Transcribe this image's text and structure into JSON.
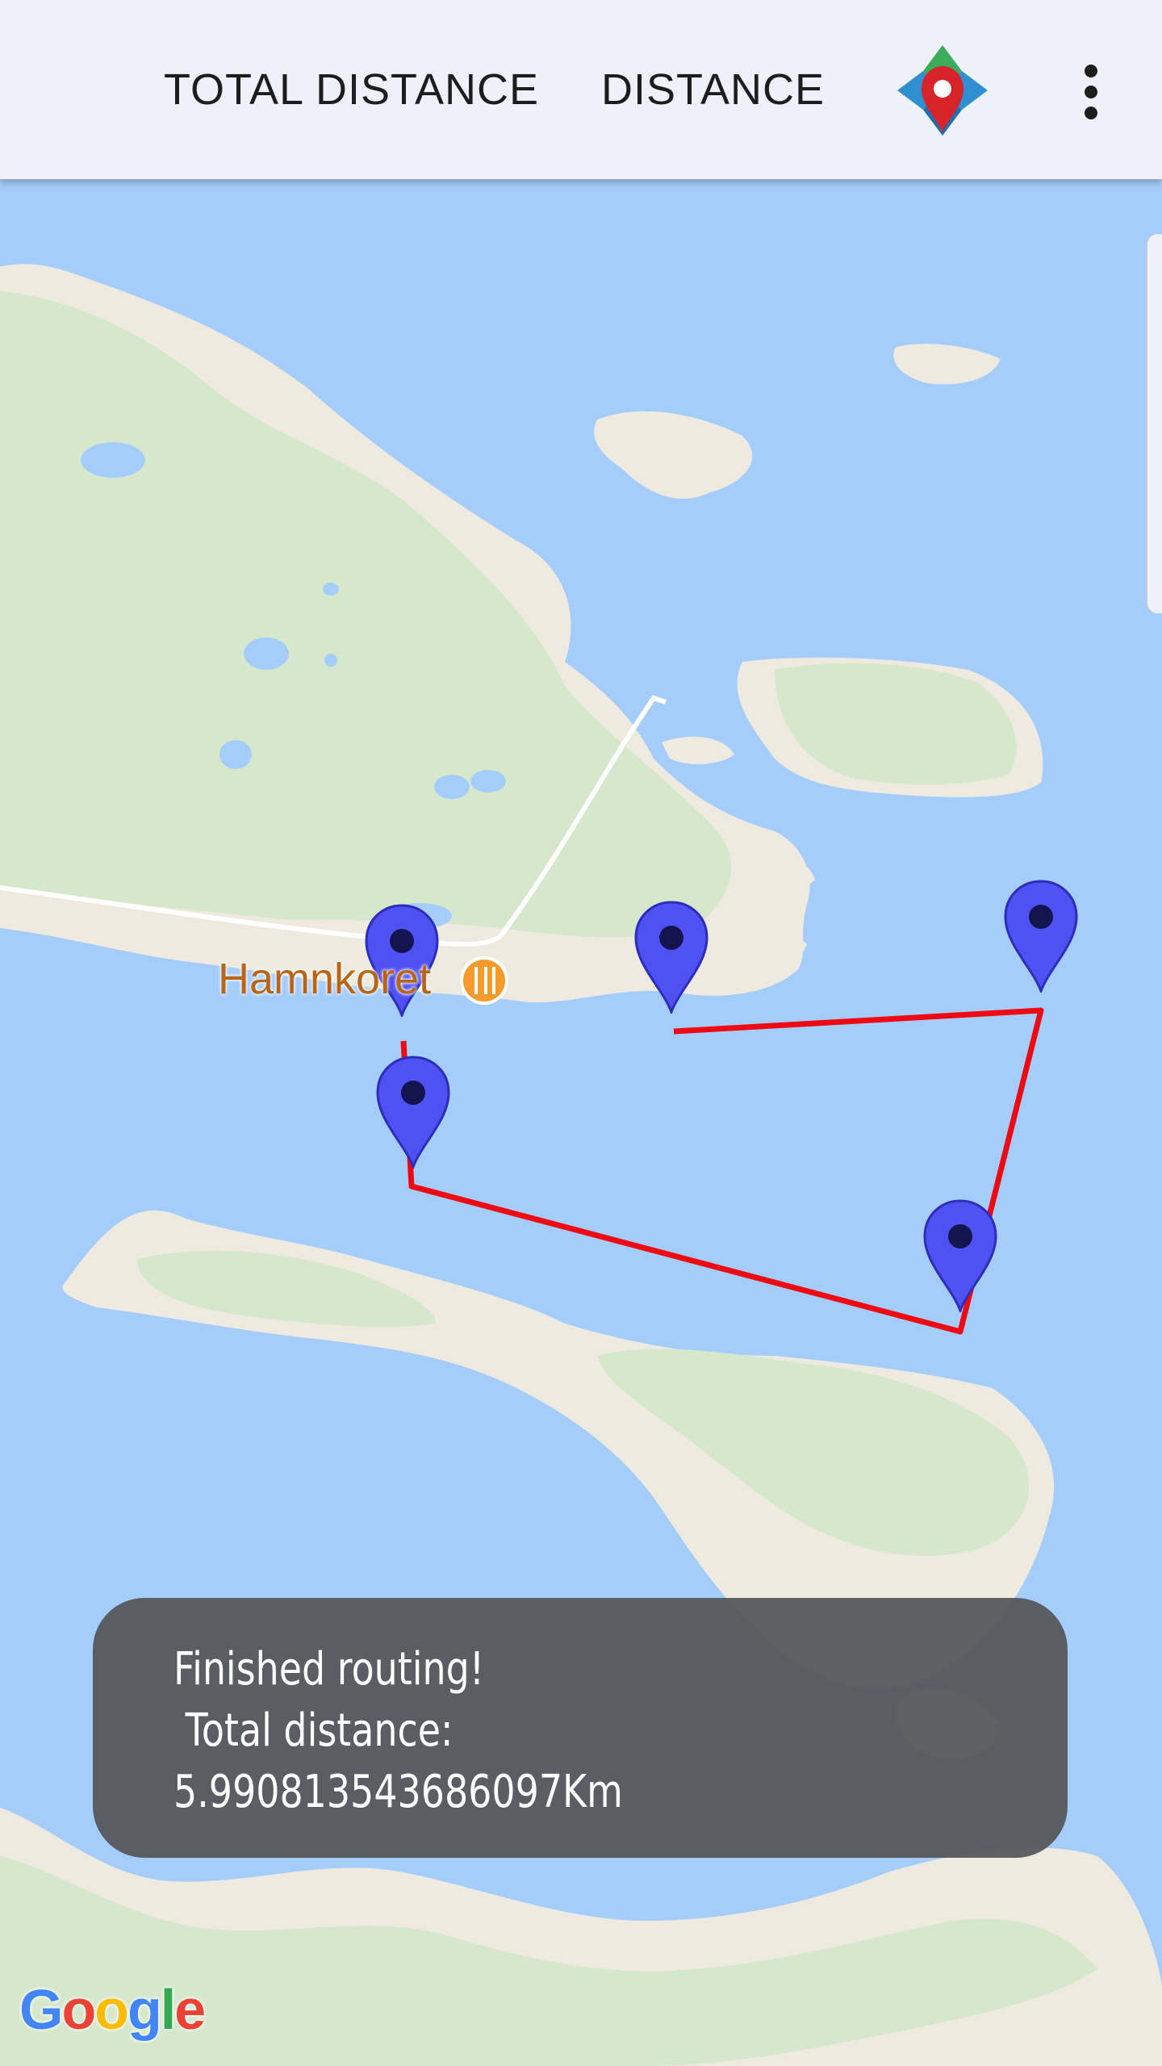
{
  "appbar": {
    "tab_total_distance": "TOTAL DISTANCE",
    "tab_distance": "DISTANCE",
    "app_icon": "map-pin-compass-icon",
    "overflow_icon": "more-vert-icon"
  },
  "map": {
    "poi_label": "Hamnkoret",
    "poi_icon": "restaurant-icon",
    "attribution": "Google",
    "colors": {
      "water": "#a4cdfb",
      "land": "#eeeadf",
      "park": "#d6e8cc",
      "route": "#ee0a12",
      "marker": "#5051f3",
      "road": "#ffffff"
    },
    "marker_count": 5
  },
  "toast": {
    "line1": "Finished routing!",
    "line2": " Total distance:",
    "line3": "5.990813543686097Km"
  },
  "google_colors": [
    "#4285f4",
    "#ea4335",
    "#fbbc05",
    "#4285f4",
    "#34a853",
    "#ea4335"
  ]
}
